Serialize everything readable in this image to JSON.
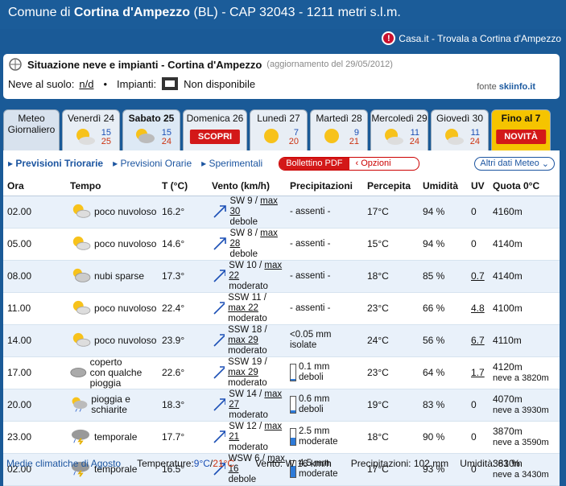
{
  "header": {
    "prefix": "Comune di ",
    "town": "Cortina d'Ampezzo",
    "rest": " (BL) - CAP 32043 - 1211 metri s.l.m."
  },
  "toplink": {
    "text": "Casa.it - Trovala a Cortina d'Ampezzo"
  },
  "snow": {
    "title": "Situazione neve e impianti - Cortina d'Ampezzo",
    "update": "(aggiornamento del 29/05/2012)",
    "neve_label": "Neve al suolo:",
    "neve_value": "n/d",
    "bullet": "•",
    "impianti_label": "Impianti:",
    "impianti_value": "Non disponibile",
    "fonte_label": "fonte",
    "fonte_value": "skiinfo.it"
  },
  "tabs": [
    {
      "label": "Meteo",
      "label2": "Giornaliero"
    },
    {
      "label": "Venerdì 24",
      "max": "15",
      "min": "25"
    },
    {
      "label": "Sabato 25",
      "max": "15",
      "min": "24"
    },
    {
      "label": "Domenica 26",
      "badge": "SCOPRI"
    },
    {
      "label": "Lunedì 27",
      "max": "7",
      "min": "20"
    },
    {
      "label": "Martedì 28",
      "max": "9",
      "min": "21"
    },
    {
      "label": "Mercoledì 29",
      "max": "11",
      "min": "24"
    },
    {
      "label": "Giovedì 30",
      "max": "11",
      "min": "24"
    },
    {
      "label": "Fino al 7",
      "badge": "NOVITÀ"
    }
  ],
  "subnav": {
    "triorarie": "Previsioni Triorarie",
    "orarie": "Previsioni Orarie",
    "sperimentali": "Sperimentali",
    "pdf": "Bollettino PDF",
    "opzioni": "Opzioni",
    "altri": "Altri dati Meteo"
  },
  "columns": [
    "Ora",
    "Tempo",
    "T (°C)",
    "Vento (km/h)",
    "Precipitazioni",
    "Percepita",
    "Umidità",
    "UV",
    "Quota 0°C"
  ],
  "rows": [
    {
      "ora": "02.00",
      "tempo": "poco nuvoloso",
      "t": "16.2°",
      "dir": "SW",
      "v": "9",
      "max": "max 30",
      "int": "debole",
      "prec": "- assenti -",
      "perc": "17°C",
      "um": "94 %",
      "uv": "0",
      "quota": "4160m"
    },
    {
      "ora": "05.00",
      "tempo": "poco nuvoloso",
      "t": "14.6°",
      "dir": "SW",
      "v": "8",
      "max": "max 28",
      "int": "debole",
      "prec": "- assenti -",
      "perc": "15°C",
      "um": "94 %",
      "uv": "0",
      "quota": "4140m"
    },
    {
      "ora": "08.00",
      "tempo": "nubi sparse",
      "t": "17.3°",
      "dir": "SW",
      "v": "10",
      "max": "max 22",
      "int": "moderato",
      "prec": "- assenti -",
      "perc": "18°C",
      "um": "85 %",
      "uv": "0.7",
      "quota": "4140m"
    },
    {
      "ora": "11.00",
      "tempo": "poco nuvoloso",
      "t": "22.4°",
      "dir": "SSW",
      "v": "11",
      "max": "max 22",
      "int": "moderato",
      "prec": "- assenti -",
      "perc": "23°C",
      "um": "66 %",
      "uv": "4.8",
      "quota": "4100m"
    },
    {
      "ora": "14.00",
      "tempo": "poco nuvoloso",
      "t": "23.9°",
      "dir": "SSW",
      "v": "18",
      "max": "max 29",
      "int": "moderato",
      "prec": "<0.05 mm",
      "prec2": "isolate",
      "perc": "24°C",
      "um": "56 %",
      "uv": "6.7",
      "quota": "4110m"
    },
    {
      "ora": "17.00",
      "tempo": "coperto",
      "tempo2": "con qualche pioggia",
      "t": "22.6°",
      "dir": "SSW",
      "v": "19",
      "max": "max 29",
      "int": "moderato",
      "prec": "0.1 mm",
      "prec2": "deboli",
      "bar": 0.1,
      "perc": "23°C",
      "um": "64 %",
      "uv": "1.7",
      "quota": "4120m",
      "quota2": "neve a 3820m"
    },
    {
      "ora": "20.00",
      "tempo": "pioggia e schiarite",
      "t": "18.3°",
      "dir": "SW",
      "v": "14",
      "max": "max 27",
      "int": "moderato",
      "prec": "0.6 mm",
      "prec2": "deboli",
      "bar": 0.15,
      "perc": "19°C",
      "um": "83 %",
      "uv": "0",
      "quota": "4070m",
      "quota2": "neve a 3930m"
    },
    {
      "ora": "23.00",
      "tempo": "temporale",
      "t": "17.7°",
      "dir": "SW",
      "v": "12",
      "max": "max 21",
      "int": "moderato",
      "prec": "2.5 mm",
      "prec2": "moderate",
      "bar": 0.45,
      "perc": "18°C",
      "um": "90 %",
      "uv": "0",
      "quota": "3870m",
      "quota2": "neve a 3590m"
    },
    {
      "ora": "02.00",
      "tempo": "temporale",
      "t": "16.5°",
      "dir": "WSW",
      "v": "6",
      "max": "max 16",
      "int": "debole",
      "prec": "4.5 mm",
      "prec2": "moderate",
      "bar": 0.7,
      "perc": "17°C",
      "um": "93 %",
      "uv": "0",
      "quota": "3810m",
      "quota2": "neve a 3430m"
    }
  ],
  "footer": {
    "medie": "Medie climatiche di Agosto",
    "temp_label": "Temperature: ",
    "tmin": "9°C",
    "slash": " / ",
    "tmax": "21°C",
    "vento": "Vento: W 16 km/h",
    "prec": "Precipitazioni: 102 mm",
    "um": "Umidità: 63 %"
  }
}
